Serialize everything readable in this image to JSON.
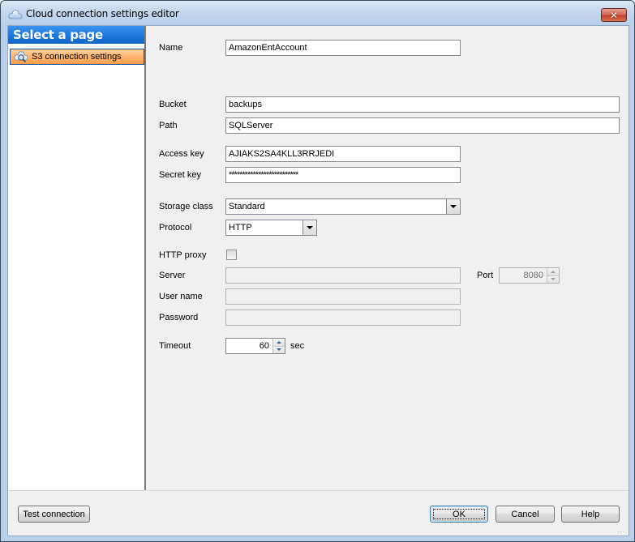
{
  "window": {
    "title": "Cloud connection settings editor",
    "icon": "cloud-icon",
    "close_icon": "close-icon",
    "close_glyph": "✕"
  },
  "sidebar": {
    "header": "Select a page",
    "items": [
      {
        "label": "S3 connection settings",
        "icon": "cloud-search-icon",
        "selected": true
      }
    ]
  },
  "form": {
    "name": {
      "label": "Name",
      "value": "AmazonEntAccount"
    },
    "bucket": {
      "label": "Bucket",
      "value": "backups"
    },
    "path": {
      "label": "Path",
      "value": "SQLServer"
    },
    "access_key": {
      "label": "Access key",
      "value": "AJIAKS2SA4KLL3RRJEDI"
    },
    "secret_key": {
      "label": "Secret key",
      "value": "**************************"
    },
    "storage_class": {
      "label": "Storage class",
      "value": "Standard"
    },
    "protocol": {
      "label": "Protocol",
      "value": "HTTP"
    },
    "http_proxy": {
      "label": "HTTP proxy",
      "checked": false
    },
    "server": {
      "label": "Server",
      "value": "",
      "enabled": false
    },
    "port": {
      "label": "Port",
      "value": "8080",
      "enabled": false
    },
    "user_name": {
      "label": "User name",
      "value": "",
      "enabled": false
    },
    "password": {
      "label": "Password",
      "value": "",
      "enabled": false
    },
    "timeout": {
      "label": "Timeout",
      "value": "60",
      "unit": "sec"
    }
  },
  "footer": {
    "test_connection": "Test connection",
    "ok": "OK",
    "cancel": "Cancel",
    "help": "Help",
    "grip": "..."
  },
  "colors": {
    "sidebar_header": "#1c74d8",
    "selected_item": "#ffb46e",
    "close_button": "#c2432b"
  }
}
